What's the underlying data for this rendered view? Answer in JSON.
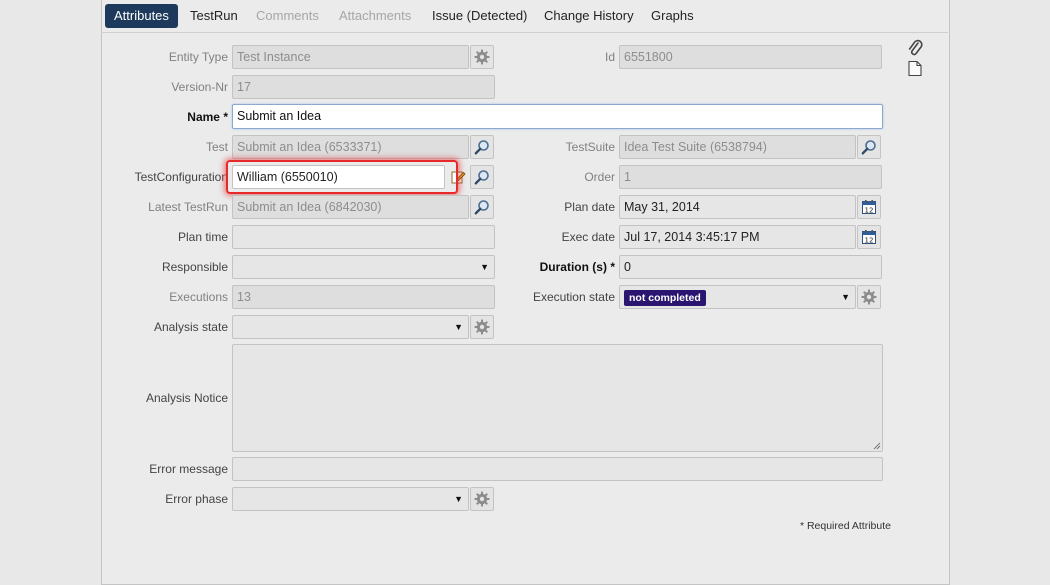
{
  "tabs": [
    "Attributes",
    "TestRun",
    "Comments",
    "Attachments",
    "Issue (Detected)",
    "Change History",
    "Graphs"
  ],
  "form": {
    "entity_type": {
      "label": "Entity Type",
      "value": "Test Instance"
    },
    "id": {
      "label": "Id",
      "value": "6551800"
    },
    "version": {
      "label": "Version-Nr",
      "value": "17"
    },
    "name": {
      "label": "Name",
      "required_mark": "*",
      "value": "Submit an Idea"
    },
    "test": {
      "label": "Test",
      "value": "Submit an Idea (6533371)"
    },
    "test_suite": {
      "label": "TestSuite",
      "value": "Idea Test Suite (6538794)"
    },
    "test_configuration": {
      "label": "TestConfiguration",
      "value": "William (6550010)"
    },
    "order": {
      "label": "Order",
      "value": "1"
    },
    "latest_testrun": {
      "label": "Latest TestRun",
      "value": "Submit an Idea (6842030)"
    },
    "plan_date": {
      "label": "Plan date",
      "value": "May 31, 2014"
    },
    "plan_time": {
      "label": "Plan time",
      "value": ""
    },
    "exec_date": {
      "label": "Exec date",
      "value": "Jul 17, 2014 3:45:17 PM"
    },
    "responsible": {
      "label": "Responsible",
      "value": ""
    },
    "duration": {
      "label": "Duration (s)",
      "required_mark": "*",
      "value": "0"
    },
    "executions": {
      "label": "Executions",
      "value": "13"
    },
    "execution_state": {
      "label": "Execution state",
      "value": "not completed"
    },
    "analysis_state": {
      "label": "Analysis state",
      "value": ""
    },
    "analysis_notice": {
      "label": "Analysis Notice",
      "value": ""
    },
    "error_message": {
      "label": "Error message",
      "value": ""
    },
    "error_phase": {
      "label": "Error phase",
      "value": ""
    }
  },
  "calendar_day": "12",
  "footer_note": "* Required Attribute",
  "colors": {
    "active_tab": "#1d3a5c",
    "badge": "#2a1571",
    "highlight": "#e62a2a"
  },
  "icons": [
    "gear-icon",
    "magnifier-icon",
    "edit-pencil-icon",
    "calendar-icon",
    "paperclip-icon",
    "document-icon",
    "dropdown-caret-icon"
  ]
}
